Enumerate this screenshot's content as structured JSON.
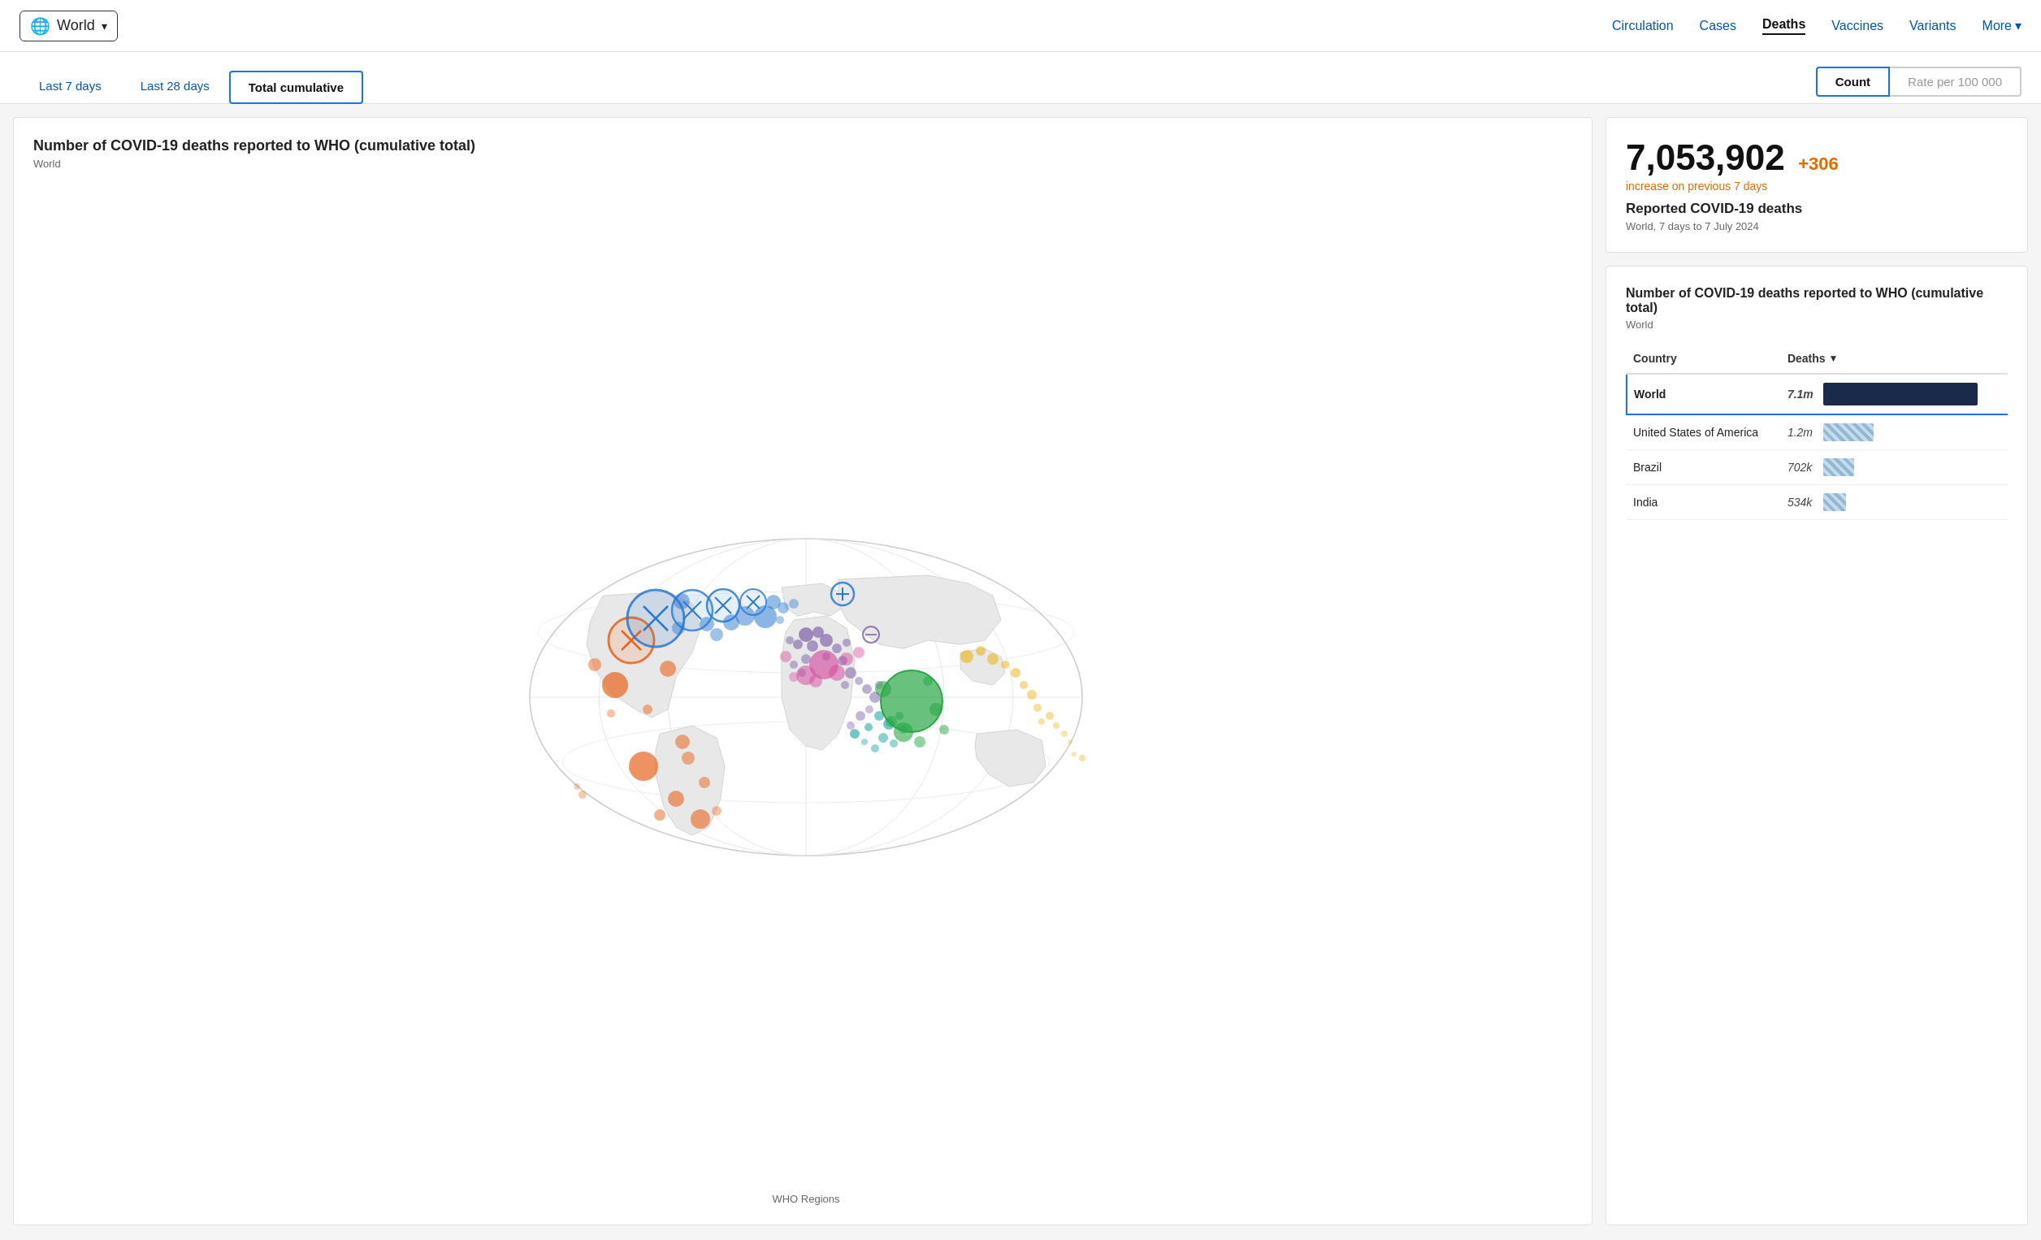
{
  "header": {
    "world_label": "World",
    "globe_icon": "🌐",
    "chevron_icon": "▾",
    "nav": {
      "items": [
        {
          "label": "Circulation",
          "active": false
        },
        {
          "label": "Cases",
          "active": false
        },
        {
          "label": "Deaths",
          "active": true
        },
        {
          "label": "Vaccines",
          "active": false
        },
        {
          "label": "Variants",
          "active": false
        },
        {
          "label": "More",
          "active": false,
          "has_chevron": true
        }
      ]
    }
  },
  "tabs": {
    "time_tabs": [
      {
        "label": "Last 7 days",
        "active": false
      },
      {
        "label": "Last 28 days",
        "active": false
      },
      {
        "label": "Total cumulative",
        "active": true
      }
    ],
    "metric_tabs": [
      {
        "label": "Count",
        "active": true
      },
      {
        "label": "Rate per 100 000",
        "active": false
      }
    ]
  },
  "map_panel": {
    "title": "Number of COVID-19 deaths reported to WHO (cumulative total)",
    "subtitle": "World",
    "legend_label": "WHO Regions"
  },
  "stats_card": {
    "big_number": "7,053,902",
    "increase": "+306",
    "increase_label": "increase on previous 7 days",
    "stat_title": "Reported COVID-19 deaths",
    "stat_date": "World, 7 days to 7 July 2024"
  },
  "table_card": {
    "title": "Number of COVID-19 deaths reported to WHO (cumulative total)",
    "subtitle": "World",
    "col_country": "Country",
    "col_deaths": "Deaths",
    "rows": [
      {
        "country": "World",
        "value": "7.1m",
        "bar_type": "full",
        "selected": true
      },
      {
        "country": "United States of America",
        "value": "1.2m",
        "bar_type": "usa",
        "selected": false
      },
      {
        "country": "Brazil",
        "value": "702k",
        "bar_type": "brazil",
        "selected": false
      },
      {
        "country": "India",
        "value": "534k",
        "bar_type": "india",
        "selected": false
      }
    ]
  }
}
